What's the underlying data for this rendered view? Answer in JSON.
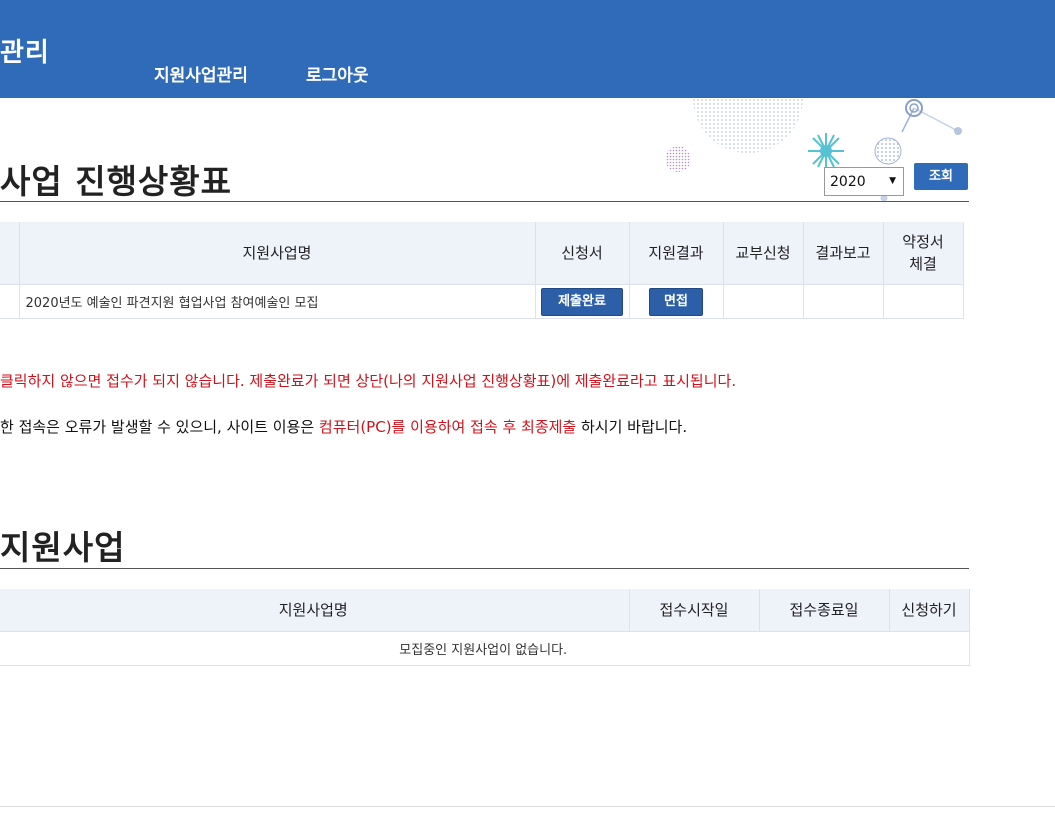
{
  "header": {
    "logo": "관리",
    "nav": [
      {
        "label": "지원사업관리"
      },
      {
        "label": "로그아웃"
      }
    ]
  },
  "progress": {
    "title": "사업 진행상황표",
    "year_value": "2020",
    "search_label": "조회",
    "columns": [
      "지원사업명",
      "신청서",
      "지원결과",
      "교부신청",
      "결과보고",
      "약정서",
      "체결"
    ],
    "rows": [
      {
        "name": "2020년도 예술인 파견지원 협업사업 참여예술인 모집",
        "application": "제출완료",
        "result": "면접",
        "grant": "",
        "report": "",
        "agreement": ""
      }
    ]
  },
  "notices": {
    "line1": "클릭하지 않으면 접수가 되지 않습니다. 제출완료가 되면 상단(나의 지원사업 진행상황표)에 제출완료라고 표시됩니다.",
    "line2_prefix": "한 접속은 오류가 발생할 수 있으니, 사이트 이용은 ",
    "line2_highlight": "컴퓨터(PC)를 이용하여 접속 후 최종제출",
    "line2_suffix": " 하시기 바랍니다."
  },
  "programs": {
    "title": "지원사업",
    "columns": [
      "지원사업명",
      "접수시작일",
      "접수종료일",
      "신청하기"
    ],
    "empty_message": "모집중인 지원사업이 없습니다."
  },
  "colors": {
    "header_bg": "#2f6bb8",
    "button_bg": "#2c5fa8",
    "table_header_bg": "#eef2f9",
    "notice_red": "#d0111b"
  }
}
